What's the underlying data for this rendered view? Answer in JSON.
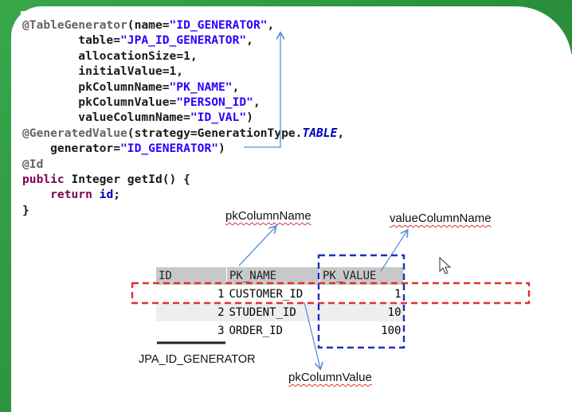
{
  "code": {
    "line1": {
      "ann": "@TableGenerator",
      "open": "(name=",
      "name": "\"ID_GENERATOR\"",
      "end": ","
    },
    "line2": {
      "pre": "        table=",
      "val": "\"JPA_ID_GENERATOR\"",
      "end": ","
    },
    "line3": "        allocationSize=1,",
    "line4": "        initialValue=1,",
    "line5": {
      "pre": "        pkColumnName=",
      "val": "\"PK_NAME\"",
      "end": ","
    },
    "line6": {
      "pre": "        pkColumnValue=",
      "val": "\"PERSON_ID\"",
      "end": ","
    },
    "line7": {
      "pre": "        valueColumnName=",
      "val": "\"ID_VAL\"",
      "end": ")"
    },
    "line8": {
      "ann": "@GeneratedValue",
      "open": "(strategy=GenerationType.",
      "enum": "TABLE",
      "end": ","
    },
    "line9": {
      "pre": "    generator=",
      "val": "\"ID_GENERATOR\"",
      "end": ")"
    },
    "line10": "@Id",
    "line11": {
      "kw": "public",
      "rest": " Integer getId() {"
    },
    "line12": {
      "kw": "    return",
      "space": " ",
      "var": "id",
      "end": ";"
    },
    "line13": "}"
  },
  "labels": {
    "pk_column_name": "pkColumnName",
    "value_column_name": "valueColumnName",
    "pk_column_value": "pkColumnValue",
    "table_name": "JPA_ID_GENERATOR"
  },
  "table": {
    "headers": [
      "ID",
      "PK_NAME",
      "PK_VALUE"
    ],
    "rows": [
      [
        "1",
        "CUSTOMER_ID",
        "1"
      ],
      [
        "2",
        "STUDENT_ID",
        "10"
      ],
      [
        "3",
        "ORDER_ID",
        "100"
      ]
    ]
  },
  "colors": {
    "annotation": "#646464",
    "string": "#2a00ff",
    "keyword": "#7f0055",
    "arrow": "#5b8fd6",
    "highlight_red": "#e0312b",
    "highlight_blue": "#1f2fbf"
  }
}
